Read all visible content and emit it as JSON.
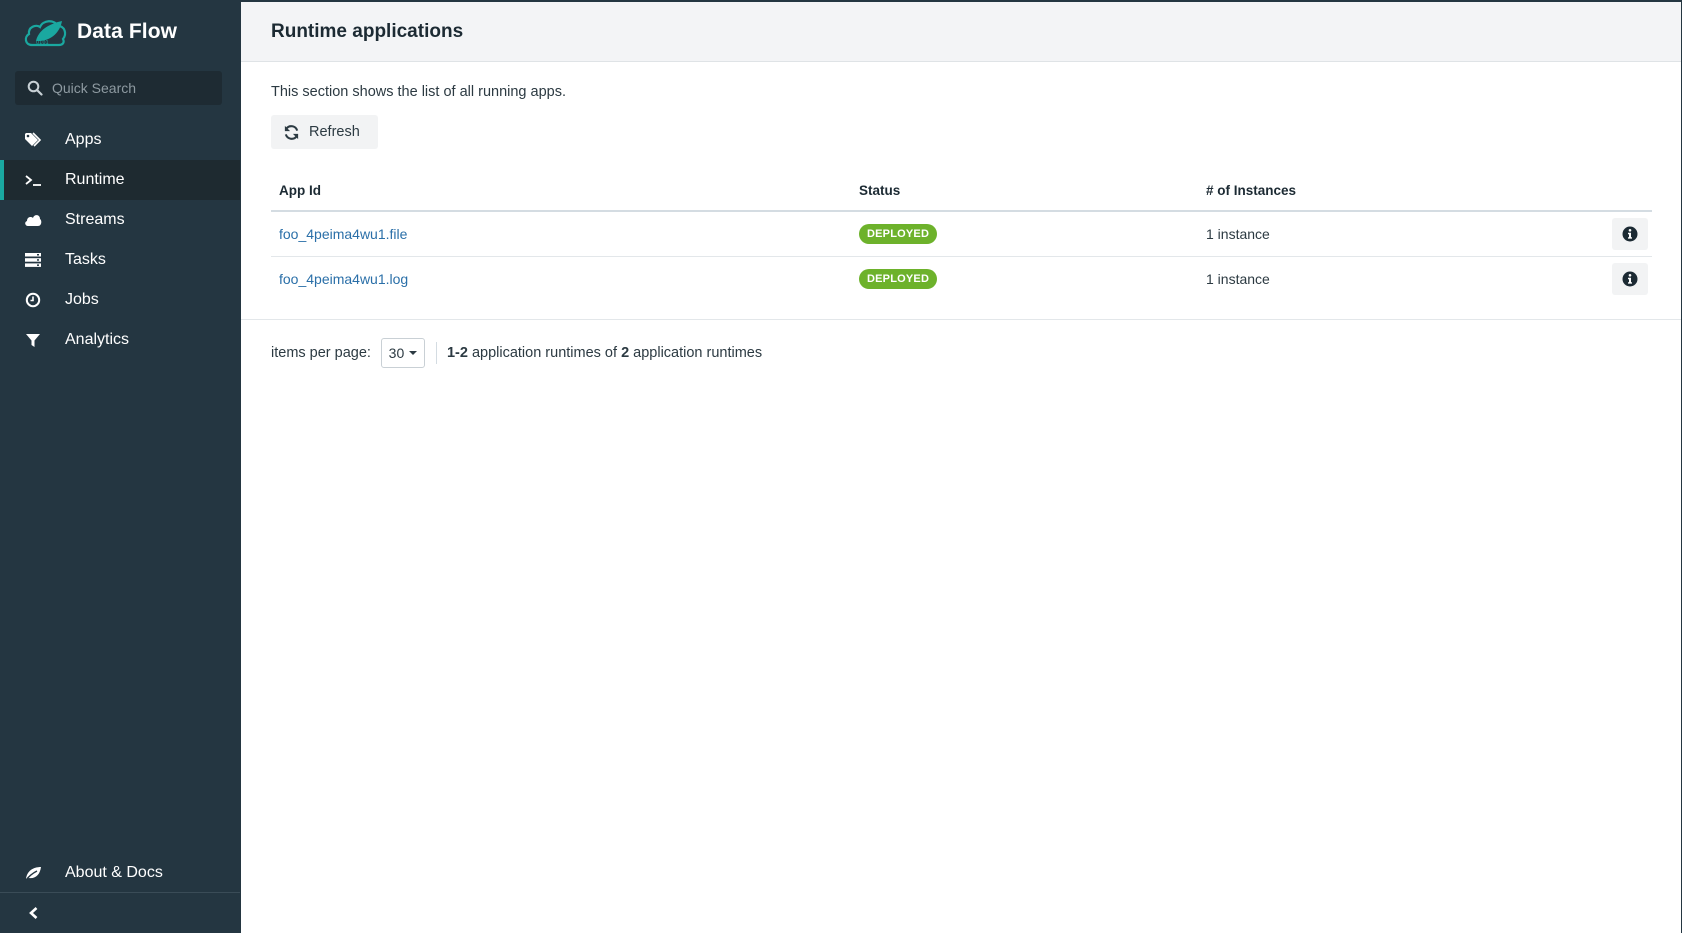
{
  "app": {
    "title": "Data Flow",
    "accent_color": "#1aa8a0"
  },
  "search": {
    "placeholder": "Quick Search",
    "value": ""
  },
  "sidebar": {
    "items": [
      {
        "label": "Apps",
        "icon": "tags-icon",
        "active": false
      },
      {
        "label": "Runtime",
        "icon": "terminal-icon",
        "active": true
      },
      {
        "label": "Streams",
        "icon": "cloud-icon",
        "active": false
      },
      {
        "label": "Tasks",
        "icon": "server-icon",
        "active": false
      },
      {
        "label": "Jobs",
        "icon": "clock-icon",
        "active": false
      },
      {
        "label": "Analytics",
        "icon": "filter-icon",
        "active": false
      }
    ],
    "about_label": "About & Docs",
    "collapse_icon": "chevron-left-icon"
  },
  "page": {
    "title": "Runtime applications",
    "description": "This section shows the list of all running apps.",
    "refresh_label": "Refresh"
  },
  "table": {
    "headers": [
      "App Id",
      "Status",
      "# of Instances",
      ""
    ],
    "rows": [
      {
        "app_id": "foo_4peima4wu1.file",
        "status": "DEPLOYED",
        "instances": "1 instance"
      },
      {
        "app_id": "foo_4peima4wu1.log",
        "status": "DEPLOYED",
        "instances": "1 instance"
      }
    ],
    "status_color": "#6db22b"
  },
  "pagination": {
    "items_per_page_label": "items per page:",
    "items_per_page_value": "30",
    "range": "1-2",
    "range_suffix": " application runtimes of ",
    "total": "2",
    "total_suffix": " application runtimes"
  }
}
